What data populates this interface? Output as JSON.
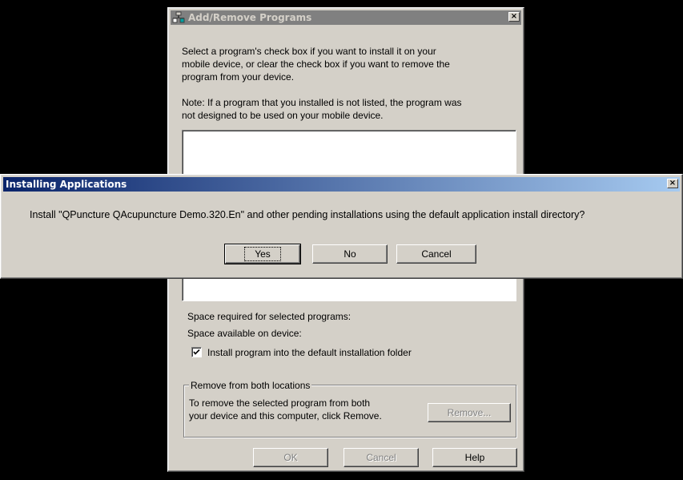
{
  "add_remove": {
    "title": "Add/Remove Programs",
    "close_glyph": "×",
    "instructions_line1": "Select a program's check box if you want to install it on your",
    "instructions_line2": "mobile device, or clear the check box if you want to remove the",
    "instructions_line3": "program from your device.",
    "note_line1": "Note:  If a program that you installed is not listed, the program was",
    "note_line2": "not designed to be used on your mobile device.",
    "space_required_label": "Space required for selected programs:",
    "space_available_label": "Space available on device:",
    "checkbox_label": "Install program into the default installation folder",
    "checkbox_checked": true,
    "remove_group_label": "Remove from both locations",
    "remove_text_line1": "To remove the selected program from both",
    "remove_text_line2": "your device and this computer, click Remove.",
    "remove_button": "Remove...",
    "ok_button": "OK",
    "cancel_button": "Cancel",
    "help_button": "Help"
  },
  "installing": {
    "title": "Installing Applications",
    "close_glyph": "×",
    "message": "Install \"QPuncture QAcupuncture Demo.320.En\" and other pending installations using the default application install directory?",
    "yes_button": "Yes",
    "no_button": "No",
    "cancel_button": "Cancel"
  },
  "colors": {
    "desktop": "#000000",
    "face": "#d4d0c8",
    "active_title_start": "#0a246a",
    "active_title_end": "#a6caf0",
    "inactive_title": "#808080"
  }
}
